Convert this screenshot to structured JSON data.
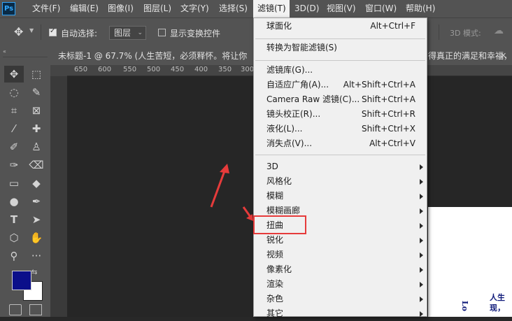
{
  "app": {
    "logo_text": "Ps"
  },
  "menubar": {
    "items": [
      {
        "label": "文件(F)"
      },
      {
        "label": "编辑(E)"
      },
      {
        "label": "图像(I)"
      },
      {
        "label": "图层(L)"
      },
      {
        "label": "文字(Y)"
      },
      {
        "label": "选择(S)"
      },
      {
        "label": "滤镜(T)"
      },
      {
        "label": "3D(D)"
      },
      {
        "label": "视图(V)"
      },
      {
        "label": "窗口(W)"
      },
      {
        "label": "帮助(H)"
      }
    ]
  },
  "options_bar": {
    "auto_select_label": "自动选择:",
    "auto_select_checked": true,
    "target_value": "图层",
    "show_transform_label": "显示变换控件",
    "mode_label": "3D 模式:"
  },
  "document_tab": {
    "title": "未标题-1 @ 67.7% (人生苦短，必须释怀。将让你",
    "title_tail": "得真正的满足和幸福，"
  },
  "ruler": {
    "ticks": [
      "650",
      "600",
      "550",
      "500",
      "450",
      "400",
      "350",
      "300"
    ]
  },
  "canvas_text": {
    "line1": "人生",
    "line2": "现，",
    "vertical": "Lo"
  },
  "filter_menu": {
    "groups": [
      [
        {
          "label": "球面化",
          "shortcut": "Alt+Ctrl+F"
        }
      ],
      [
        {
          "label": "转换为智能滤镜(S)",
          "shortcut": ""
        }
      ],
      [
        {
          "label": "滤镜库(G)...",
          "shortcut": ""
        },
        {
          "label": "自适应广角(A)...",
          "shortcut": "Alt+Shift+Ctrl+A"
        },
        {
          "label": "Camera Raw 滤镜(C)...",
          "shortcut": "Shift+Ctrl+A"
        },
        {
          "label": "镜头校正(R)...",
          "shortcut": "Shift+Ctrl+R"
        },
        {
          "label": "液化(L)...",
          "shortcut": "Shift+Ctrl+X"
        },
        {
          "label": "消失点(V)...",
          "shortcut": "Alt+Ctrl+V"
        }
      ],
      [
        {
          "label": "3D",
          "submenu": true
        },
        {
          "label": "风格化",
          "submenu": true
        },
        {
          "label": "模糊",
          "submenu": true
        },
        {
          "label": "模糊画廊",
          "submenu": true
        },
        {
          "label": "扭曲",
          "submenu": true
        },
        {
          "label": "锐化",
          "submenu": true
        },
        {
          "label": "视频",
          "submenu": true
        },
        {
          "label": "像素化",
          "submenu": true
        },
        {
          "label": "渲染",
          "submenu": true
        },
        {
          "label": "杂色",
          "submenu": true
        },
        {
          "label": "其它",
          "submenu": true
        }
      ]
    ]
  },
  "colors": {
    "foreground": "#0b0f8a",
    "background": "#ffffff",
    "annotation": "#e63b3b"
  }
}
